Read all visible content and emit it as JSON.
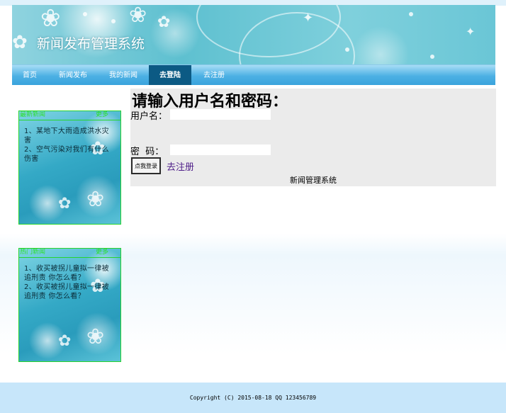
{
  "site": {
    "title": "新闻发布管理系统"
  },
  "nav": {
    "items": [
      {
        "label": "首页"
      },
      {
        "label": "新闻发布"
      },
      {
        "label": "我的新闻"
      },
      {
        "label": "去登陆"
      },
      {
        "label": "去注册"
      }
    ]
  },
  "sidebar": {
    "boxes": [
      {
        "title": "最新新闻",
        "more": "更多",
        "items": [
          "1、某地下大雨造成洪水灾害",
          "2、空气污染对我们有什么伤害"
        ]
      },
      {
        "title": "热门新闻",
        "more": "更多",
        "items": [
          "1、收买被拐儿童拟一律被追刑责 你怎么看？",
          "2、收买被拐儿童拟一律被追刑责 你怎么看？"
        ]
      }
    ]
  },
  "login": {
    "heading": "请输入用户名和密码：",
    "username_label": "用户名：",
    "username_value": "",
    "password_label": "密  码：",
    "password_value": "",
    "submit_label": "点我登录",
    "register_link": "去注册",
    "footer_text": "新闻管理系统"
  },
  "footer": {
    "copyright": "Copyright (C) 2015-08-18   QQ 123456789"
  },
  "colors": {
    "nav_active": "#0c5a84",
    "box_border": "#27d42e",
    "register_link": "#50208a",
    "footer_bg": "#c7e6fa"
  }
}
